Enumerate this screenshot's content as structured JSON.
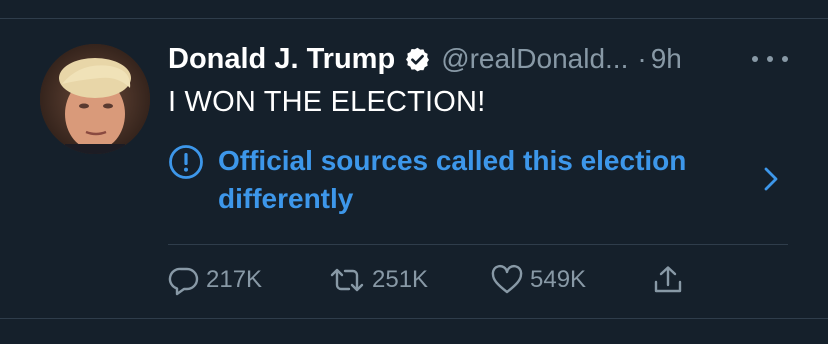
{
  "tweet": {
    "author_name": "Donald J. Trump",
    "handle": "@realDonald...",
    "separator": "·",
    "time": "9h",
    "text": "I WON THE ELECTION!",
    "notice": "Official sources called this election differently"
  },
  "actions": {
    "replies": "217K",
    "retweets": "251K",
    "likes": "549K"
  },
  "icons": {
    "avatar": "profile-photo",
    "verified": "verified-badge-icon",
    "more": "more-options-icon",
    "notice": "exclamation-circle-icon",
    "chevron": "chevron-right-icon",
    "reply": "reply-icon",
    "retweet": "retweet-icon",
    "like": "heart-icon",
    "share": "share-icon"
  },
  "colors": {
    "background": "#15202b",
    "text_primary": "#ffffff",
    "text_secondary": "#8899a6",
    "accent": "#3d97ea",
    "divider": "#2f3d4b"
  }
}
